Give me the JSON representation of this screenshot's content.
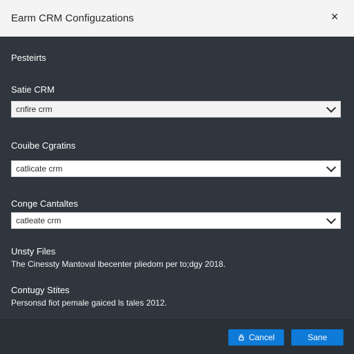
{
  "window": {
    "title": "Earm CRM Configuzations",
    "close_icon": "close-icon",
    "close_glyph": "×"
  },
  "content": {
    "section_heading": "Pesteirts",
    "fields": [
      {
        "label": "Satie CRM",
        "value": "cnfire crm"
      },
      {
        "label": "Couibe Cgratins",
        "value": "catlicate crm"
      },
      {
        "label": "Conge Cantaltes",
        "value": "catleate crm"
      }
    ],
    "info": [
      {
        "title": "Unsty Files",
        "text": "The Cinessty Mantoval lbecenter pliedom per to;dgy 2018."
      },
      {
        "title": "Contugy Stites",
        "text": "Personsd fiot pemale gaiced ls tales 2012."
      }
    ],
    "dropdown_icon": "chevron-down-icon"
  },
  "footer": {
    "cancel_label": "Cancel",
    "cancel_icon": "lock-icon",
    "save_label": "Sane"
  },
  "colors": {
    "background": "#2f363d",
    "titlebar": "#f4f4f4",
    "accent": "#0f7bd8",
    "text_light": "#ffffff"
  }
}
